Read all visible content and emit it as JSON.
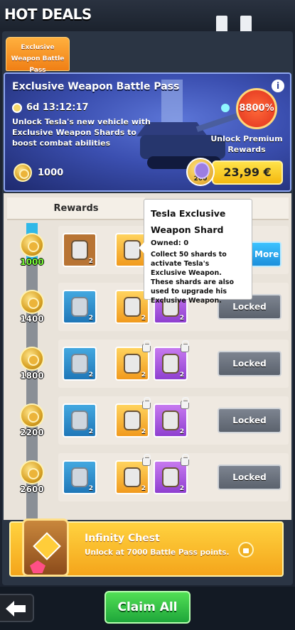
{
  "header": {
    "title": "HOT DEALS",
    "pause_icon": "pause-icon"
  },
  "tab": {
    "label": "Exclusive Weapon Battle Pass"
  },
  "banner": {
    "title": "Exclusive Weapon Battle Pass",
    "timer": "6d 13:12:17",
    "description": "Unlock Tesla's new vehicle with Exclusive Weapon Shards to boost combat abilities",
    "points": "1000",
    "bonus_percent": "8800%",
    "unlock_label": "Unlock Premium Rewards",
    "price": "23,99 €",
    "coin_amount": "200"
  },
  "rewards": {
    "header": "Rewards",
    "rows": [
      {
        "level": "1000",
        "button": "More"
      },
      {
        "level": "1400",
        "button": "Locked"
      },
      {
        "level": "1800",
        "button": "Locked"
      },
      {
        "level": "2200",
        "button": "Locked"
      },
      {
        "level": "2600",
        "button": "Locked"
      }
    ],
    "item_qty": "2"
  },
  "tooltip": {
    "title": "Tesla Exclusive Weapon Shard",
    "owned": "Owned: 0",
    "body": "Collect 50 shards to activate Tesla's Exclusive Weapon. These shards are also used to upgrade his Exclusive Weapon."
  },
  "infinity_chest": {
    "title": "Infinity Chest",
    "description": "Unlock at 7000 Battle Pass points."
  },
  "footer": {
    "claim_label": "Claim All"
  },
  "colors": {
    "accent": "#f4b80f",
    "claim": "#1ea63a",
    "panel": "#3b4fb0"
  }
}
